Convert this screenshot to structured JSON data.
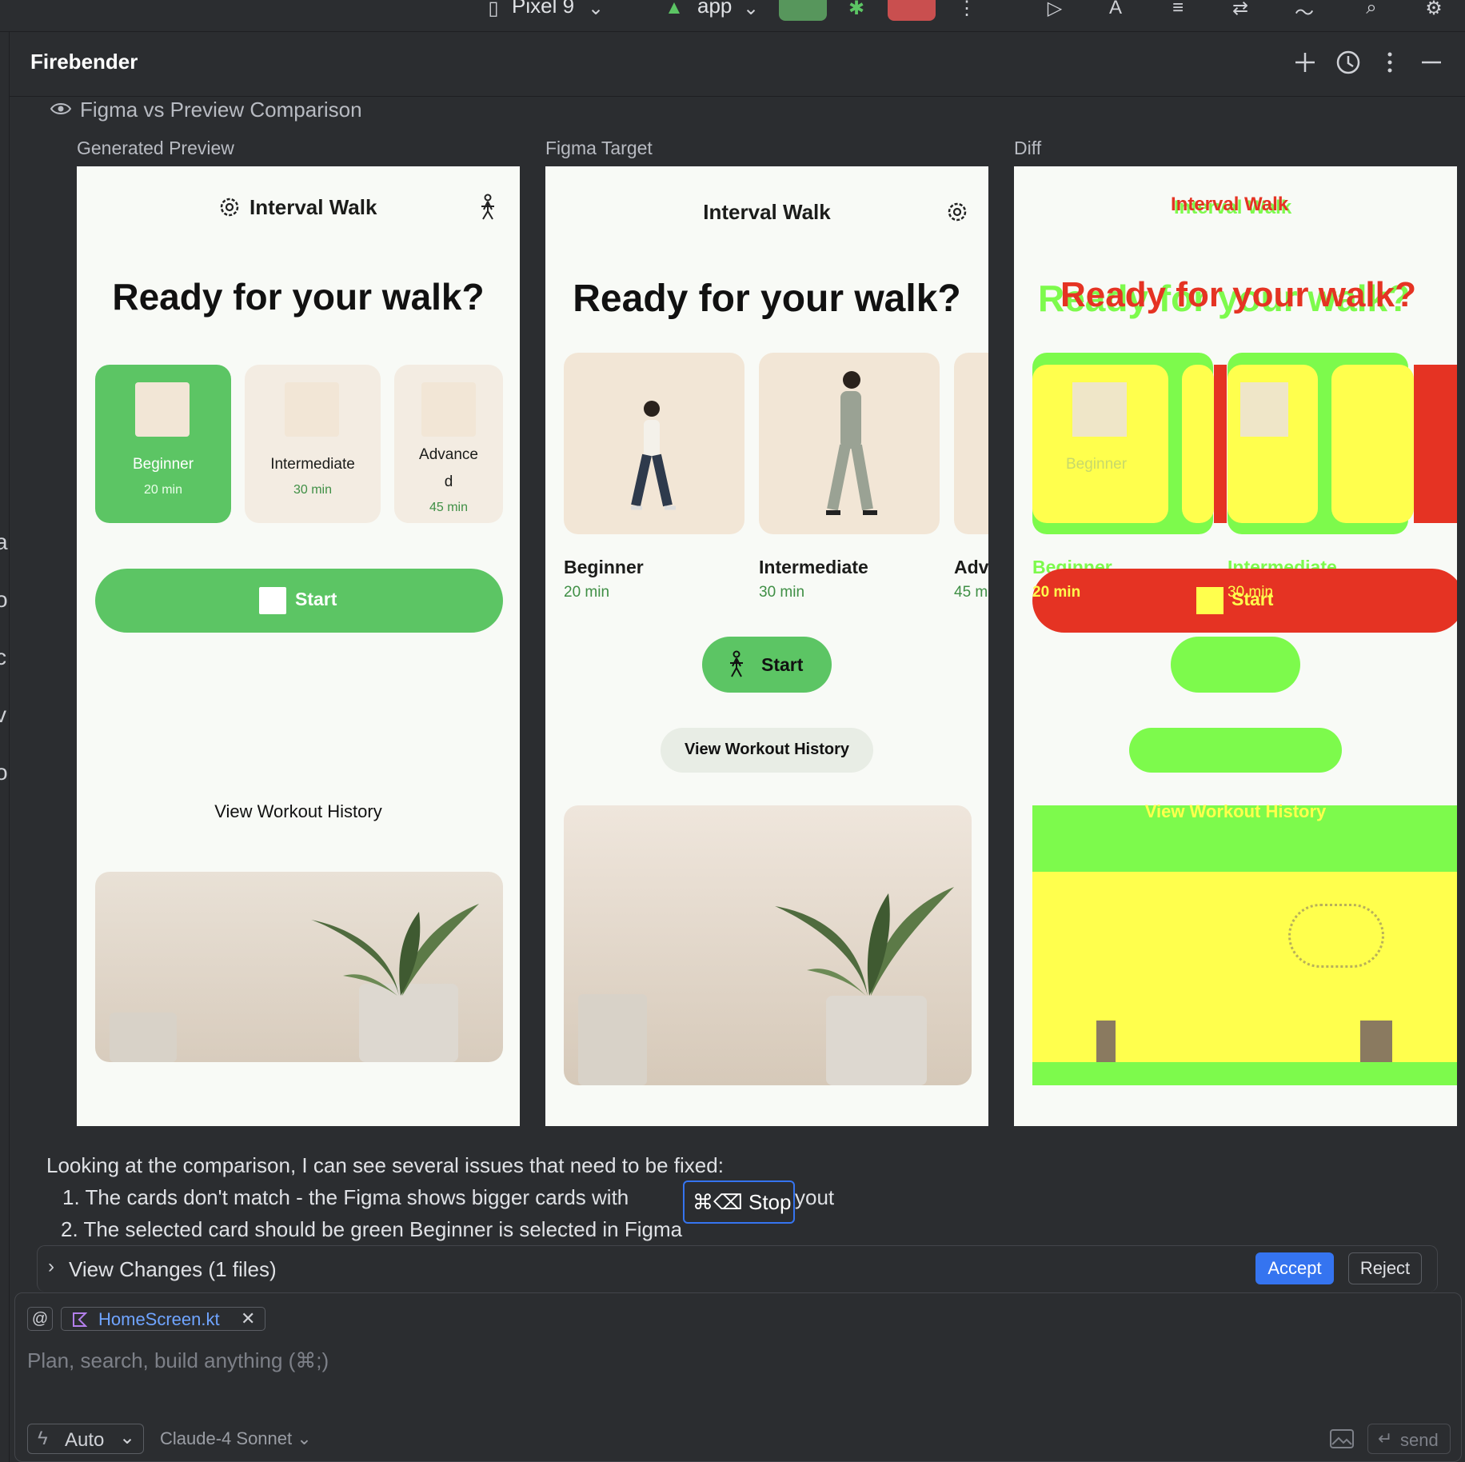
{
  "toolbar": {
    "device": "Pixel 9",
    "module": "app"
  },
  "panel": {
    "title": "Firebender"
  },
  "comparison": {
    "title": "Figma vs Preview Comparison",
    "columns": [
      "Generated Preview",
      "Figma Target",
      "Diff"
    ]
  },
  "preview": {
    "app_title": "Interval Walk",
    "heading": "Ready for your walk?",
    "cards": [
      {
        "name": "Beginner",
        "time": "20 min"
      },
      {
        "name": "Intermediate",
        "time": "30 min"
      },
      {
        "name": "Advance\nd",
        "time": "45 min"
      }
    ],
    "start_label": "Start",
    "history_label": "View Workout History"
  },
  "figma": {
    "app_title": "Interval Walk",
    "heading": "Ready for your walk?",
    "cards": [
      {
        "name": "Beginner",
        "time": "20 min"
      },
      {
        "name": "Intermediate",
        "time": "30 min"
      },
      {
        "name": "Adv",
        "time": "45 m"
      }
    ],
    "start_label": "Start",
    "history_label": "View Workout History"
  },
  "diff": {
    "app_title": "Interval Walk",
    "heading": "Ready for your walk?",
    "card_labels": [
      "Beginner",
      "Beginner",
      "Intermediate"
    ],
    "time_labels": [
      "20 min",
      "30 min"
    ],
    "start_label": "Start",
    "history_label": "View Workout History"
  },
  "chat": {
    "intro": "Looking at the comparison, I can see several issues that need to be fixed:",
    "items": [
      "1. The cards don't match - the Figma shows bigger cards with",
      "2. The selected card should be green Beginner is selected in Figma"
    ],
    "item1_tail": "yout",
    "stop_label": "⌘⌫ Stop"
  },
  "changes": {
    "label": "View Changes (1 files)",
    "accept": "Accept",
    "reject": "Reject"
  },
  "input": {
    "at": "@",
    "file": "HomeScreen.kt",
    "placeholder": "Plan, search, build anything (⌘;)",
    "mode": "Auto",
    "model": "Claude-4 Sonnet",
    "send": "send"
  },
  "colors": {
    "accent_green": "#5cc564",
    "diff_green": "#7dfa4c",
    "diff_yellow": "#ffff4d",
    "diff_red": "#e53323",
    "blue": "#3574f0"
  }
}
